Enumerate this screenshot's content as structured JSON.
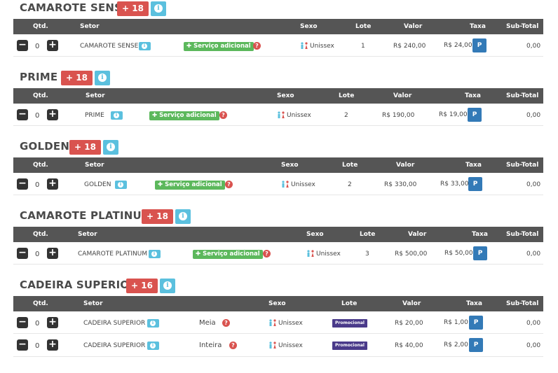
{
  "sections": [
    {
      "title": "CAMAROTE SENSE",
      "age": "+ 18",
      "headers": {
        "qtd": "Qtd.",
        "setor": "Setor",
        "sexo": "Sexo",
        "lote": "Lote",
        "valor": "Valor",
        "taxa": "Taxa",
        "subtotal": "Sub-Total"
      },
      "rows": [
        {
          "qty": "0",
          "setor": "CAMAROTE SENSE",
          "servico": "✚ Serviço adicional",
          "sexo": "Unissex",
          "lote": "1",
          "valor": "R$ 240,00",
          "taxa": "R$ 24,00",
          "p": "P",
          "subtotal": "0,00"
        }
      ]
    },
    {
      "title": "PRIME",
      "age": "+ 18",
      "headers": {
        "qtd": "Qtd.",
        "setor": "Setor",
        "sexo": "Sexo",
        "lote": "Lote",
        "valor": "Valor",
        "taxa": "Taxa",
        "subtotal": "Sub-Total"
      },
      "rows": [
        {
          "qty": "0",
          "setor": "PRIME",
          "servico": "✚ Serviço adicional",
          "sexo": "Unissex",
          "lote": "2",
          "valor": "R$ 190,00",
          "taxa": "R$ 19,00",
          "p": "P",
          "subtotal": "0,00"
        }
      ]
    },
    {
      "title": "GOLDEN",
      "age": "+ 18",
      "headers": {
        "qtd": "Qtd.",
        "setor": "Setor",
        "sexo": "Sexo",
        "lote": "Lote",
        "valor": "Valor",
        "taxa": "Taxa",
        "subtotal": "Sub-Total"
      },
      "rows": [
        {
          "qty": "0",
          "setor": "GOLDEN",
          "servico": "✚ Serviço adicional",
          "sexo": "Unissex",
          "lote": "2",
          "valor": "R$ 330,00",
          "taxa": "R$ 33,00",
          "p": "P",
          "subtotal": "0,00"
        }
      ]
    },
    {
      "title": "CAMAROTE PLATINUM",
      "age": "+ 18",
      "headers": {
        "qtd": "Qtd.",
        "setor": "Setor",
        "sexo": "Sexo",
        "lote": "Lote",
        "valor": "Valor",
        "taxa": "Taxa",
        "subtotal": "Sub-Total"
      },
      "rows": [
        {
          "qty": "0",
          "setor": "CAMAROTE PLATINUM",
          "servico": "✚ Serviço adicional",
          "sexo": "Unissex",
          "lote": "3",
          "valor": "R$ 500,00",
          "taxa": "R$ 50,00",
          "p": "P",
          "subtotal": "0,00"
        }
      ]
    },
    {
      "title": "CADEIRA SUPERIOR",
      "age": "+ 16",
      "headers": {
        "qtd": "Qtd.",
        "setor": "Setor",
        "sexo": "Sexo",
        "lote": "Lote",
        "valor": "Valor",
        "taxa": "Taxa",
        "subtotal": "Sub-Total"
      },
      "rows": [
        {
          "qty": "0",
          "setor": "CADEIRA SUPERIOR",
          "tipo": "Meia",
          "sexo": "Unissex",
          "lote": "Promocional",
          "valor": "R$ 20,00",
          "taxa": "R$ 1,00",
          "p": "P",
          "subtotal": "0,00"
        },
        {
          "qty": "0",
          "setor": "CADEIRA SUPERIOR",
          "tipo": "Inteira",
          "sexo": "Unissex",
          "lote": "Promocional",
          "valor": "R$ 40,00",
          "taxa": "R$ 2,00",
          "p": "P",
          "subtotal": "0,00"
        }
      ]
    }
  ],
  "icons": {
    "minus": "minus-icon",
    "plus": "plus-icon",
    "info": "info-icon",
    "question": "question-icon",
    "unisex": "unisex-icon"
  },
  "colors": {
    "age_badge": "#d9534f",
    "info": "#5bc0de",
    "service": "#5cb85c",
    "promo": "#4a3a8a",
    "p_button": "#337ab7",
    "header": "#555555"
  }
}
